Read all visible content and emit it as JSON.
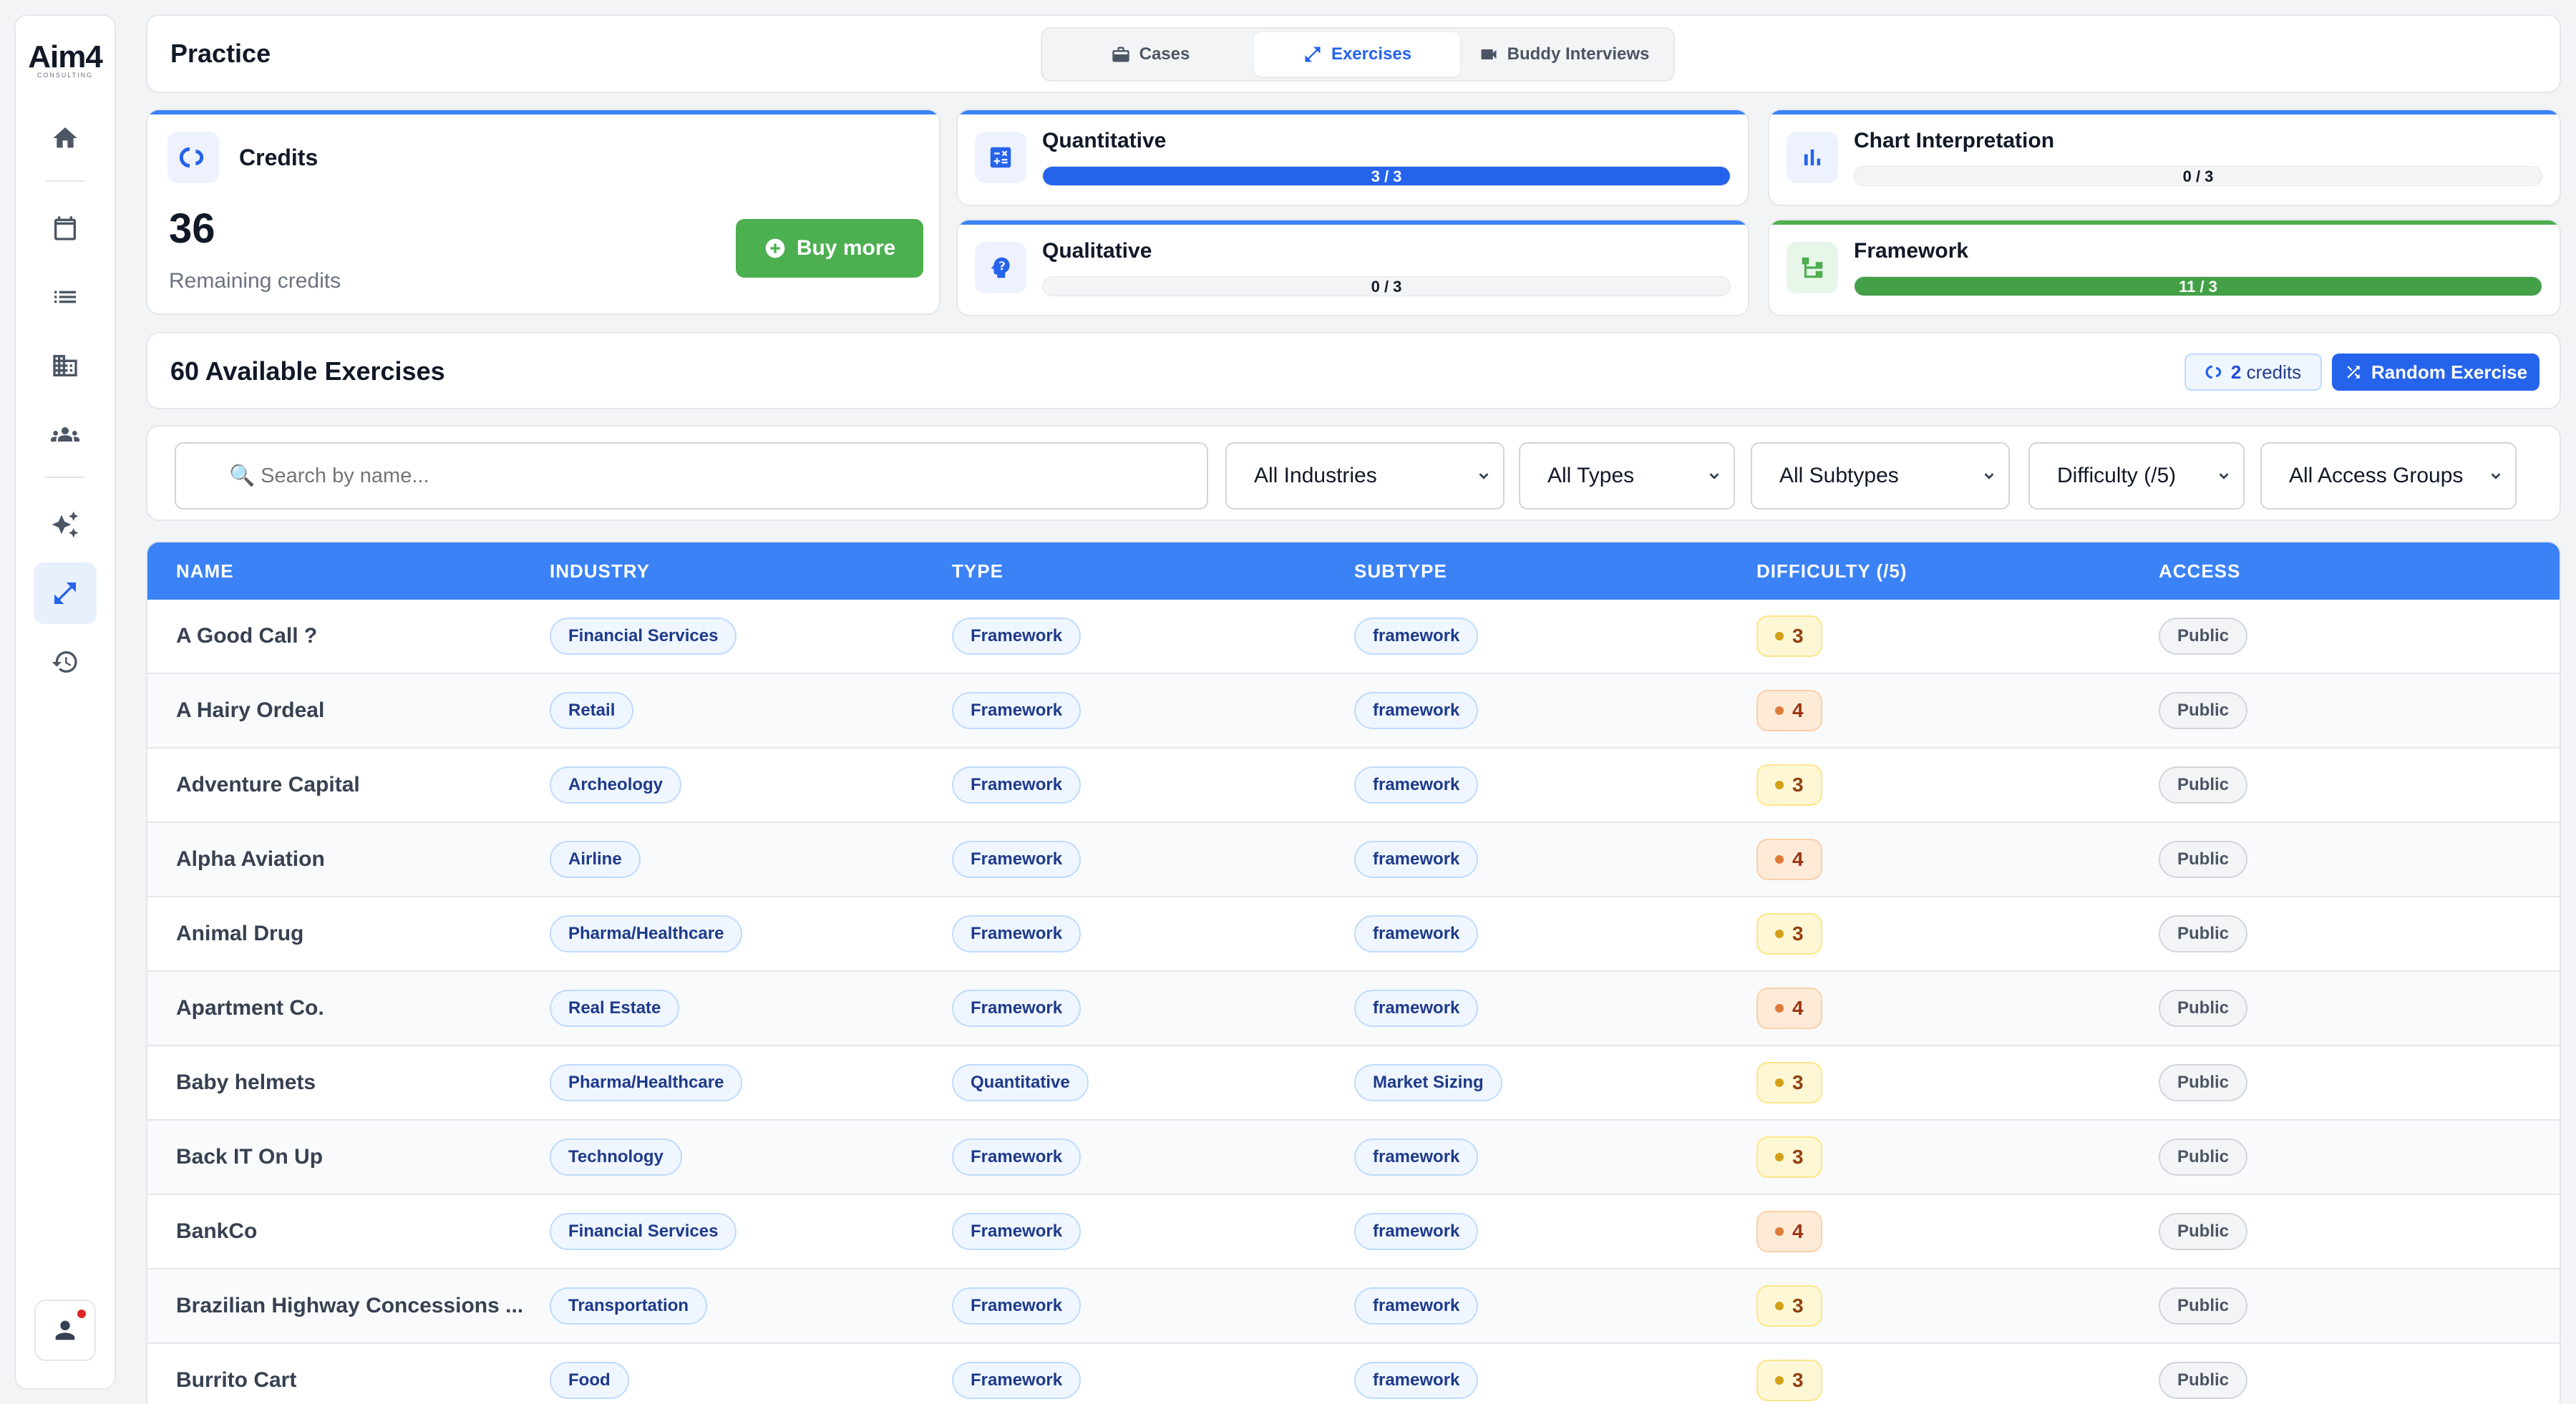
{
  "sidebar": {
    "logo_main": "Aim4",
    "logo_sub": "CONSULTING",
    "items": [
      {
        "name": "home"
      },
      {
        "name": "calendar"
      },
      {
        "name": "list"
      },
      {
        "name": "companies"
      },
      {
        "name": "groups"
      },
      {
        "name": "ai"
      },
      {
        "name": "exercises"
      },
      {
        "name": "history"
      }
    ]
  },
  "header": {
    "title": "Practice",
    "tabs": [
      {
        "label": "Cases",
        "icon": "briefcase-icon"
      },
      {
        "label": "Exercises",
        "icon": "arrows-icon",
        "active": true
      },
      {
        "label": "Buddy Interviews",
        "icon": "video-icon"
      }
    ]
  },
  "credits": {
    "title": "Credits",
    "value": "36",
    "label": "Remaining credits",
    "buy_label": "Buy more"
  },
  "stats": {
    "quantitative": {
      "title": "Quantitative",
      "progress": "3 / 3",
      "done": 3,
      "total": 3
    },
    "chart": {
      "title": "Chart Interpretation",
      "progress": "0 / 3",
      "done": 0,
      "total": 3
    },
    "qualitative": {
      "title": "Qualitative",
      "progress": "0 / 3",
      "done": 0,
      "total": 3
    },
    "framework": {
      "title": "Framework",
      "progress": "11 / 3",
      "done": 11,
      "total": 3
    }
  },
  "available": {
    "title": "60 Available Exercises",
    "credits_count": "2",
    "credits_word": "credits",
    "random_label": "Random Exercise"
  },
  "filters": {
    "search_placeholder": "🔍 Search by name...",
    "industries": "All Industries",
    "types": "All Types",
    "subtypes": "All Subtypes",
    "difficulty": "Difficulty (/5)",
    "access": "All Access Groups"
  },
  "table": {
    "headers": [
      "NAME",
      "INDUSTRY",
      "TYPE",
      "SUBTYPE",
      "DIFFICULTY (/5)",
      "ACCESS"
    ],
    "rows": [
      {
        "name": "A Good Call ?",
        "industry": "Financial Services",
        "type": "Framework",
        "subtype": "framework",
        "difficulty": "3",
        "access": "Public"
      },
      {
        "name": "A Hairy Ordeal",
        "industry": "Retail",
        "type": "Framework",
        "subtype": "framework",
        "difficulty": "4",
        "access": "Public"
      },
      {
        "name": "Adventure Capital",
        "industry": "Archeology",
        "type": "Framework",
        "subtype": "framework",
        "difficulty": "3",
        "access": "Public"
      },
      {
        "name": "Alpha Aviation",
        "industry": "Airline",
        "type": "Framework",
        "subtype": "framework",
        "difficulty": "4",
        "access": "Public"
      },
      {
        "name": "Animal Drug",
        "industry": "Pharma/Healthcare",
        "type": "Framework",
        "subtype": "framework",
        "difficulty": "3",
        "access": "Public"
      },
      {
        "name": "Apartment Co.",
        "industry": "Real Estate",
        "type": "Framework",
        "subtype": "framework",
        "difficulty": "4",
        "access": "Public"
      },
      {
        "name": "Baby helmets",
        "industry": "Pharma/Healthcare",
        "type": "Quantitative",
        "subtype": "Market Sizing",
        "difficulty": "3",
        "access": "Public"
      },
      {
        "name": "Back IT On Up",
        "industry": "Technology",
        "type": "Framework",
        "subtype": "framework",
        "difficulty": "3",
        "access": "Public"
      },
      {
        "name": "BankCo",
        "industry": "Financial Services",
        "type": "Framework",
        "subtype": "framework",
        "difficulty": "4",
        "access": "Public"
      },
      {
        "name": "Brazilian Highway Concessions ...",
        "industry": "Transportation",
        "type": "Framework",
        "subtype": "framework",
        "difficulty": "3",
        "access": "Public"
      },
      {
        "name": "Burrito Cart",
        "industry": "Food",
        "type": "Framework",
        "subtype": "framework",
        "difficulty": "3",
        "access": "Public"
      }
    ]
  }
}
